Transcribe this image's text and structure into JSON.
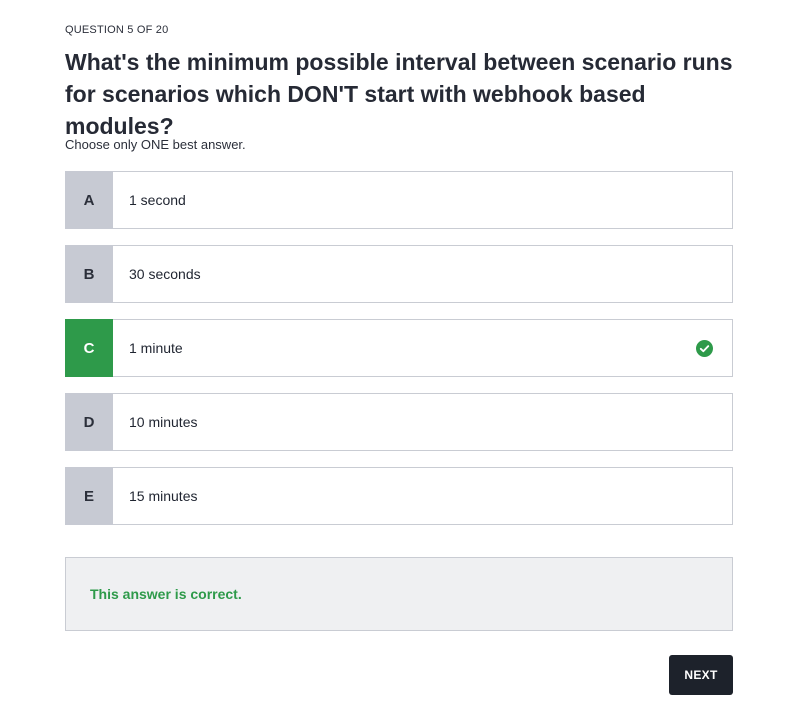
{
  "progress_label": "QUESTION 5 OF 20",
  "question": "What's the minimum possible interval between scenario runs for scenarios which DON'T start with webhook based modules?",
  "instruction": "Choose only ONE best answer.",
  "options": [
    {
      "letter": "A",
      "text": "1 second",
      "state": "unselected"
    },
    {
      "letter": "B",
      "text": "30 seconds",
      "state": "unselected"
    },
    {
      "letter": "C",
      "text": "1 minute",
      "state": "correct"
    },
    {
      "letter": "D",
      "text": "10 minutes",
      "state": "unselected"
    },
    {
      "letter": "E",
      "text": "15 minutes",
      "state": "unselected"
    }
  ],
  "feedback": "This answer is correct.",
  "next_label": "NEXT",
  "icons": {
    "correct": "check-circle-icon"
  },
  "colors": {
    "correct": "#2e9a4a",
    "letter_bg": "#c7cad3",
    "button_bg": "#1d222b",
    "feedback_bg": "#eff0f2"
  }
}
